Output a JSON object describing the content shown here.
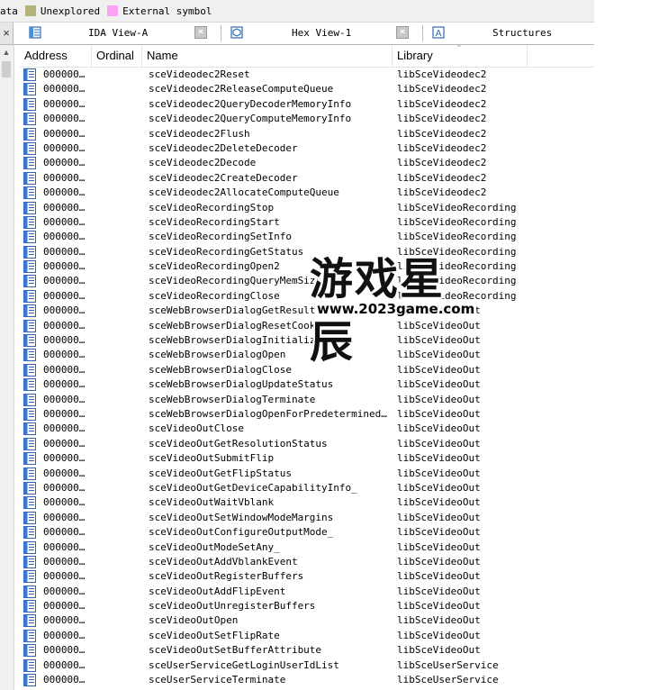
{
  "legend": {
    "items": [
      {
        "label": "ata",
        "color": ""
      },
      {
        "label": "Unexplored",
        "color": "#b5b27a"
      },
      {
        "label": "External symbol",
        "color": "#f9a3f4"
      }
    ]
  },
  "tabs": [
    {
      "label": "IDA View-A",
      "icon": "ida-view-icon"
    },
    {
      "label": "Hex View-1",
      "icon": "hex-view-icon"
    },
    {
      "label": "Structures",
      "icon": "structures-icon"
    }
  ],
  "columns": {
    "address": "Address",
    "ordinal": "Ordinal",
    "name": "Name",
    "library": "Library"
  },
  "rows": [
    {
      "address": "000000…",
      "name": "sceVideodec2Reset",
      "library": "libSceVideodec2"
    },
    {
      "address": "000000…",
      "name": "sceVideodec2ReleaseComputeQueue",
      "library": "libSceVideodec2"
    },
    {
      "address": "000000…",
      "name": "sceVideodec2QueryDecoderMemoryInfo",
      "library": "libSceVideodec2"
    },
    {
      "address": "000000…",
      "name": "sceVideodec2QueryComputeMemoryInfo",
      "library": "libSceVideodec2"
    },
    {
      "address": "000000…",
      "name": "sceVideodec2Flush",
      "library": "libSceVideodec2"
    },
    {
      "address": "000000…",
      "name": "sceVideodec2DeleteDecoder",
      "library": "libSceVideodec2"
    },
    {
      "address": "000000…",
      "name": "sceVideodec2Decode",
      "library": "libSceVideodec2"
    },
    {
      "address": "000000…",
      "name": "sceVideodec2CreateDecoder",
      "library": "libSceVideodec2"
    },
    {
      "address": "000000…",
      "name": "sceVideodec2AllocateComputeQueue",
      "library": "libSceVideodec2"
    },
    {
      "address": "000000…",
      "name": "sceVideoRecordingStop",
      "library": "libSceVideoRecording"
    },
    {
      "address": "000000…",
      "name": "sceVideoRecordingStart",
      "library": "libSceVideoRecording"
    },
    {
      "address": "000000…",
      "name": "sceVideoRecordingSetInfo",
      "library": "libSceVideoRecording"
    },
    {
      "address": "000000…",
      "name": "sceVideoRecordingGetStatus",
      "library": "libSceVideoRecording"
    },
    {
      "address": "000000…",
      "name": "sceVideoRecordingOpen2",
      "library": "libSceVideoRecording"
    },
    {
      "address": "000000…",
      "name": "sceVideoRecordingQueryMemSize2",
      "library": "libSceVideoRecording"
    },
    {
      "address": "000000…",
      "name": "sceVideoRecordingClose",
      "library": "libSceVideoRecording"
    },
    {
      "address": "000000…",
      "name": "sceWebBrowserDialogGetResult",
      "library": "libSceVideoOut"
    },
    {
      "address": "000000…",
      "name": "sceWebBrowserDialogResetCookie",
      "library": "libSceVideoOut"
    },
    {
      "address": "000000…",
      "name": "sceWebBrowserDialogInitialize",
      "library": "libSceVideoOut"
    },
    {
      "address": "000000…",
      "name": "sceWebBrowserDialogOpen",
      "library": "libSceVideoOut"
    },
    {
      "address": "000000…",
      "name": "sceWebBrowserDialogClose",
      "library": "libSceVideoOut"
    },
    {
      "address": "000000…",
      "name": "sceWebBrowserDialogUpdateStatus",
      "library": "libSceVideoOut"
    },
    {
      "address": "000000…",
      "name": "sceWebBrowserDialogTerminate",
      "library": "libSceVideoOut"
    },
    {
      "address": "000000…",
      "name": "sceWebBrowserDialogOpenForPredeterminedCon…",
      "library": "libSceVideoOut"
    },
    {
      "address": "000000…",
      "name": "sceVideoOutClose",
      "library": "libSceVideoOut"
    },
    {
      "address": "000000…",
      "name": "sceVideoOutGetResolutionStatus",
      "library": "libSceVideoOut"
    },
    {
      "address": "000000…",
      "name": "sceVideoOutSubmitFlip",
      "library": "libSceVideoOut"
    },
    {
      "address": "000000…",
      "name": "sceVideoOutGetFlipStatus",
      "library": "libSceVideoOut"
    },
    {
      "address": "000000…",
      "name": "sceVideoOutGetDeviceCapabilityInfo_",
      "library": "libSceVideoOut"
    },
    {
      "address": "000000…",
      "name": "sceVideoOutWaitVblank",
      "library": "libSceVideoOut"
    },
    {
      "address": "000000…",
      "name": "sceVideoOutSetWindowModeMargins",
      "library": "libSceVideoOut"
    },
    {
      "address": "000000…",
      "name": "sceVideoOutConfigureOutputMode_",
      "library": "libSceVideoOut"
    },
    {
      "address": "000000…",
      "name": "sceVideoOutModeSetAny_",
      "library": "libSceVideoOut"
    },
    {
      "address": "000000…",
      "name": "sceVideoOutAddVblankEvent",
      "library": "libSceVideoOut"
    },
    {
      "address": "000000…",
      "name": "sceVideoOutRegisterBuffers",
      "library": "libSceVideoOut"
    },
    {
      "address": "000000…",
      "name": "sceVideoOutAddFlipEvent",
      "library": "libSceVideoOut"
    },
    {
      "address": "000000…",
      "name": "sceVideoOutUnregisterBuffers",
      "library": "libSceVideoOut"
    },
    {
      "address": "000000…",
      "name": "sceVideoOutOpen",
      "library": "libSceVideoOut"
    },
    {
      "address": "000000…",
      "name": "sceVideoOutSetFlipRate",
      "library": "libSceVideoOut"
    },
    {
      "address": "000000…",
      "name": "sceVideoOutSetBufferAttribute",
      "library": "libSceVideoOut"
    },
    {
      "address": "000000…",
      "name": "sceUserServiceGetLoginUserIdList",
      "library": "libSceUserService"
    },
    {
      "address": "000000…",
      "name": "sceUserServiceTerminate",
      "library": "libSceUserService"
    }
  ],
  "watermark": {
    "main": "游戏星辰",
    "url": "www.2023game.com"
  }
}
